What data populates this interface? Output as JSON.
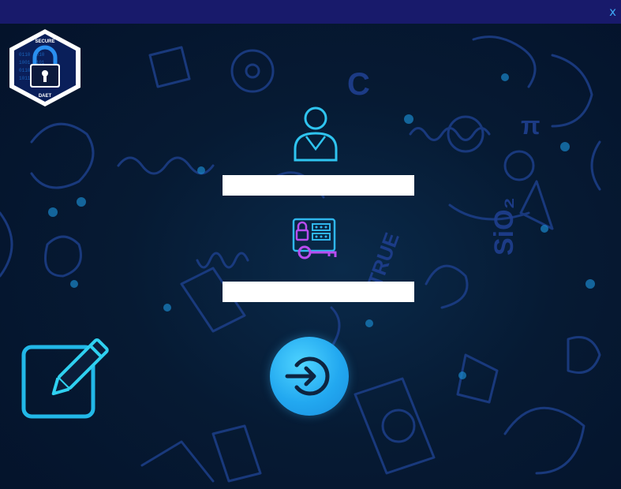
{
  "window": {
    "close_label": "x"
  },
  "logo": {
    "top_text": "SECURE",
    "bottom_text": "DAET"
  },
  "username_field": {
    "value": "",
    "placeholder": ""
  },
  "password_field": {
    "value": "",
    "placeholder": ""
  },
  "icons": {
    "user": "user-icon",
    "lock_keypad": "lock-keypad-icon",
    "login": "login-arrow-icon",
    "edit": "edit-pencil-icon"
  },
  "colors": {
    "titlebar": "#181a6b",
    "background": "#061a33",
    "accent_cyan": "#2fc4f0",
    "accent_purple": "#b84cf0",
    "button": "#22a8f0"
  }
}
